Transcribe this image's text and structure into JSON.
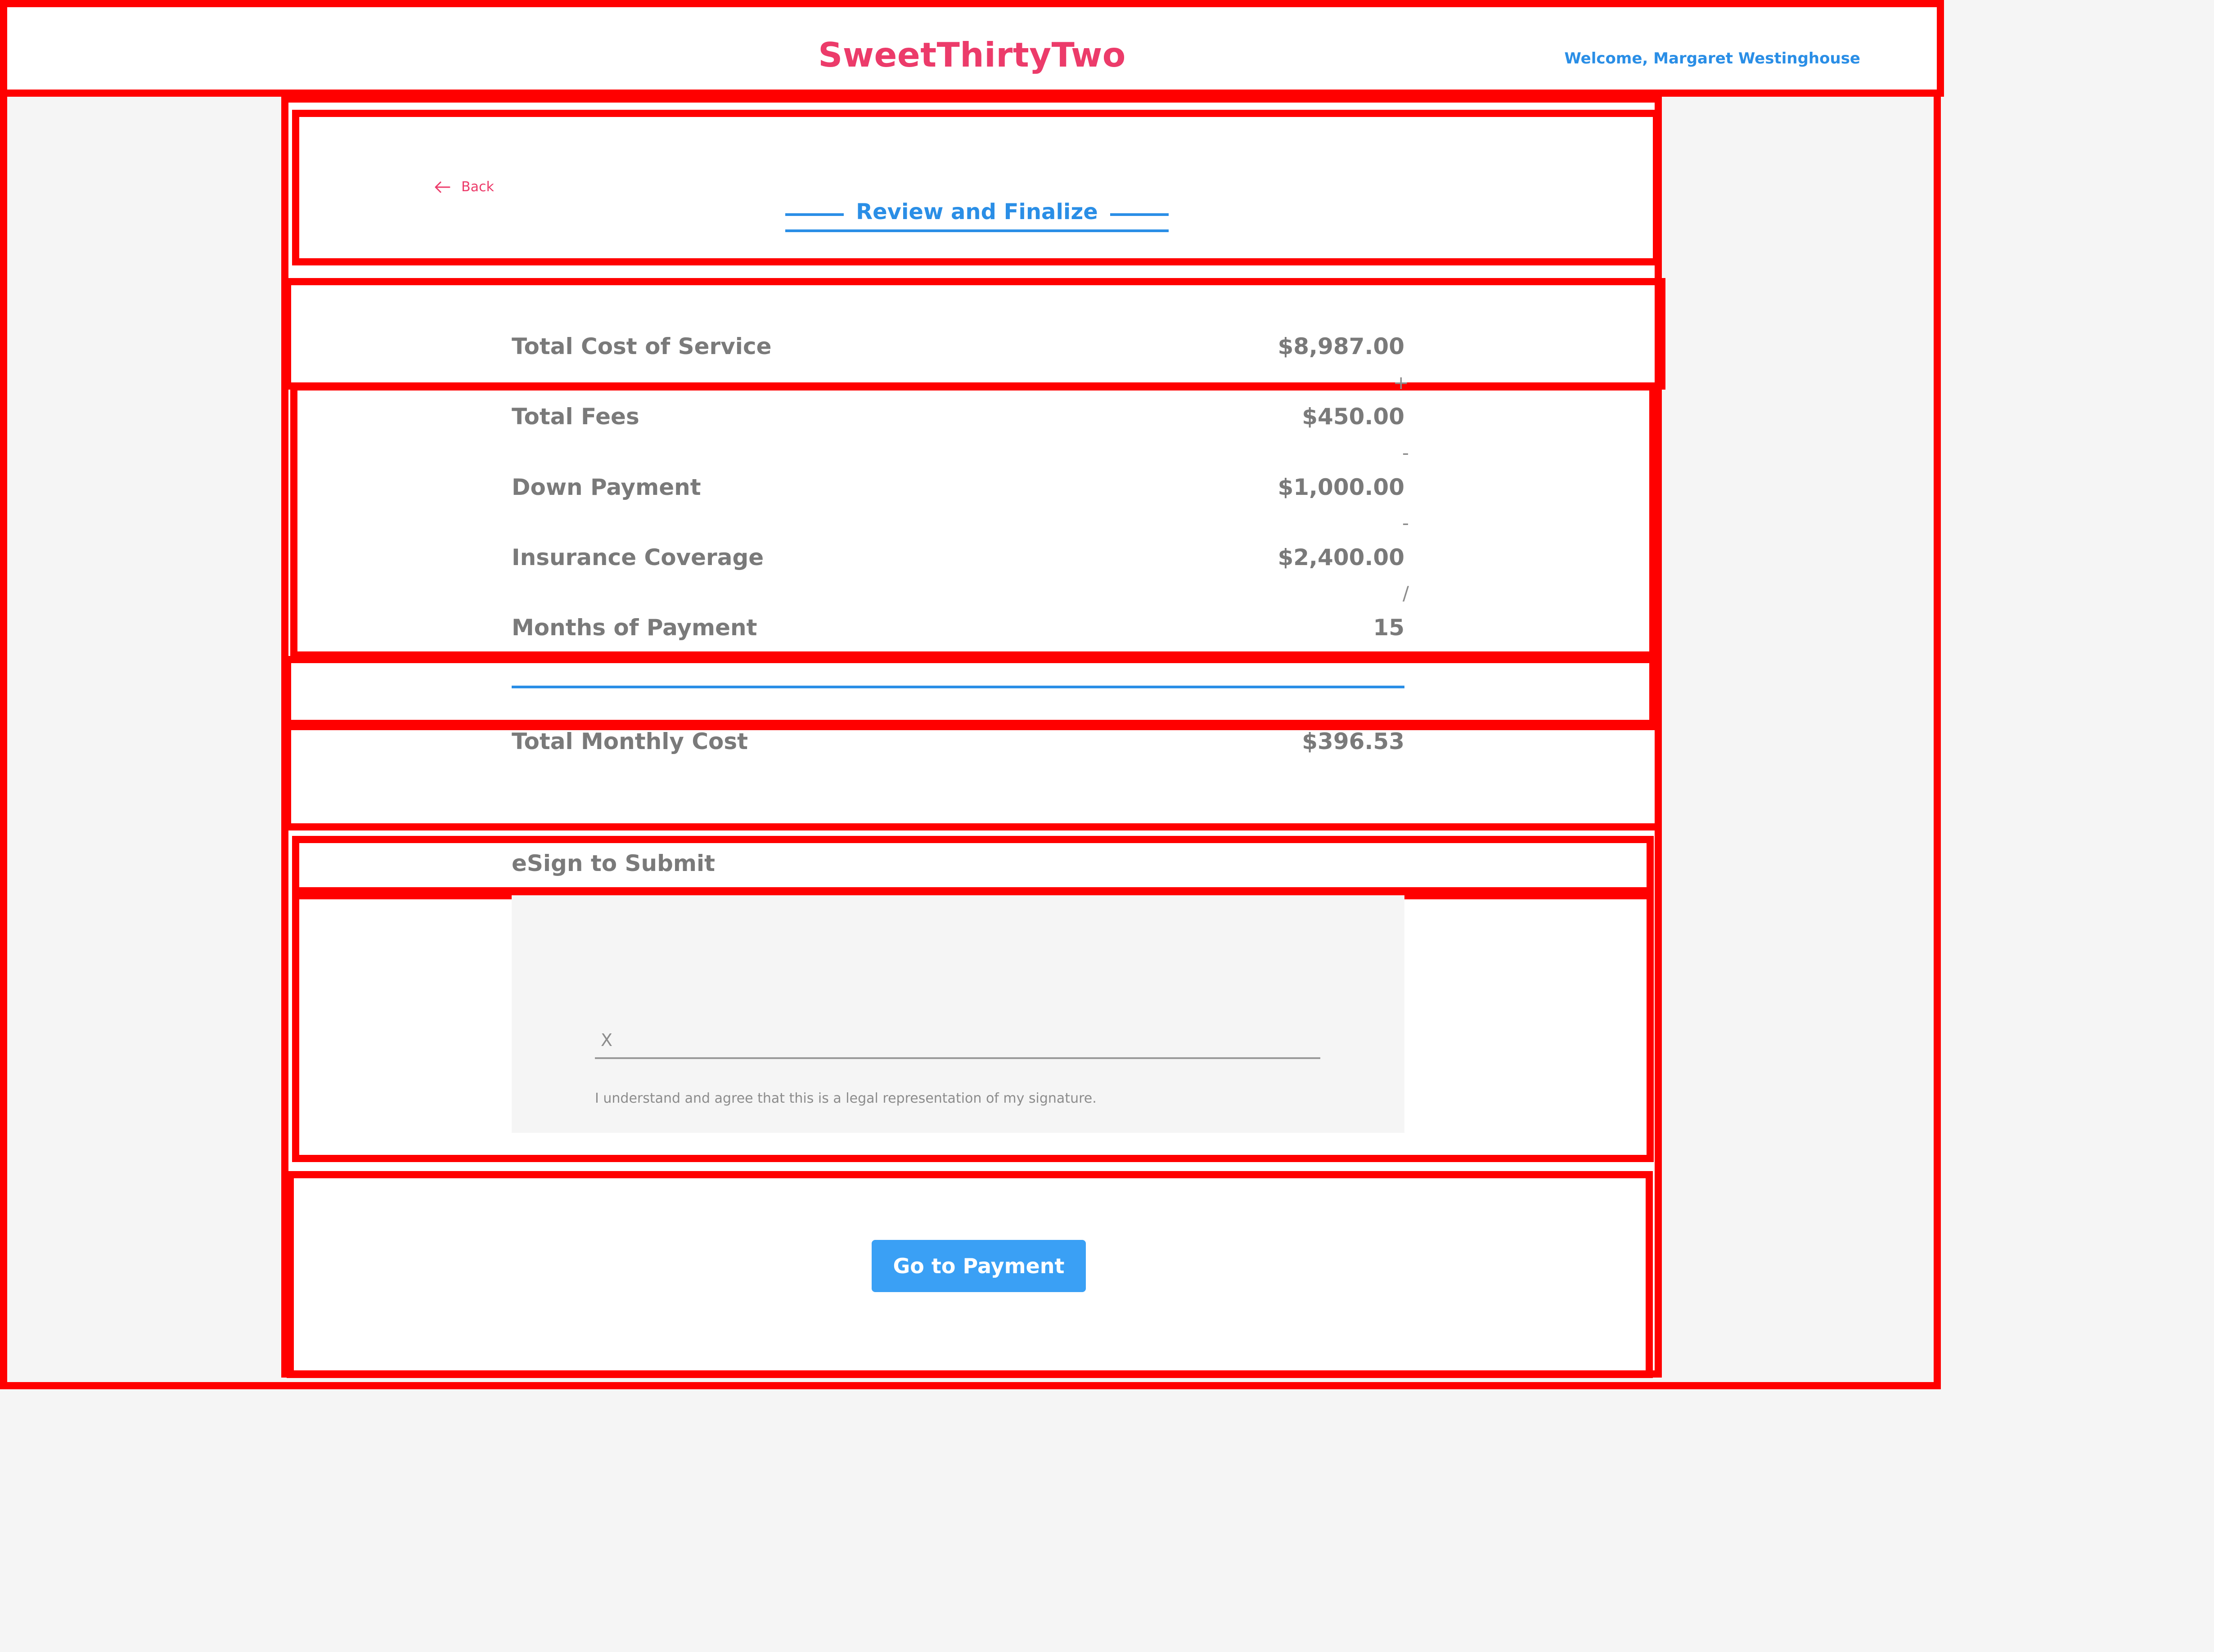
{
  "header": {
    "brand": "SweetThirtyTwo",
    "welcome": "Welcome, Margaret Westinghouse"
  },
  "nav": {
    "back_label": "Back",
    "back_icon": "arrow-left-icon"
  },
  "page": {
    "title": "Review and Finalize"
  },
  "summary": {
    "total_cost": {
      "label": "Total Cost of Service",
      "value": "$8,987.00"
    },
    "fees": {
      "label": "Total Fees",
      "value": "$450.00",
      "op": "+"
    },
    "down_payment": {
      "label": "Down Payment",
      "value": "$1,000.00",
      "op": "-"
    },
    "insurance": {
      "label": "Insurance Coverage",
      "value": "$2,400.00",
      "op": "-"
    },
    "months": {
      "label": "Months of Payment",
      "value": "15",
      "op": "/"
    },
    "monthly": {
      "label": "Total Monthly Cost",
      "value": "$396.53"
    }
  },
  "esign": {
    "title": "eSign to Submit",
    "x_mark": "X",
    "note": "I understand and agree that this is a legal representation of my signature."
  },
  "actions": {
    "payment_label": "Go to Payment"
  },
  "colors": {
    "brand": "#ec3b6a",
    "accent": "#2a8ee6",
    "button": "#3aa0f5",
    "text": "#7a7a7a",
    "annotation": "#ff0000"
  }
}
